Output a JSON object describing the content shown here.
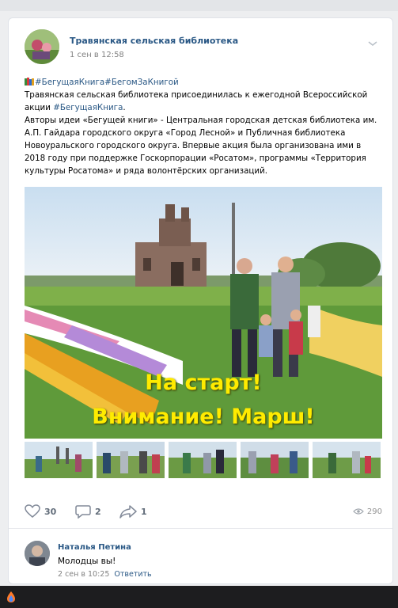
{
  "post": {
    "author": "Травянская сельская библиотека",
    "date": "1 сен в 12:58",
    "hashtags": "#БегущаяКнига#БегомЗаКнигой",
    "paragraph1_a": "Травянская сельская библиотека присоединилась к ежегодной Всероссийской акции ",
    "paragraph1_tag": "#БегущаяКнига",
    "paragraph1_b": ".",
    "paragraph2": "Авторы идеи «Бегущей книги» - Центральная городская детская библиотека им. А.П. Гайдара городского округа «Город Лесной» и Публичная библиотека Новоуральского городского округа. Впервые акция была организована ими в 2018 году при поддержке Госкорпорации «Росатом», программы «Территория культуры Росатома» и ряда волонтёрских организаций.",
    "photo_caption_line1": "На старт!",
    "photo_caption_line2": "Внимание! Марш!",
    "likes": "30",
    "comments": "2",
    "shares": "1",
    "views": "290"
  },
  "comment": {
    "author": "Наталья Петина",
    "text": "Молодцы вы!",
    "date": "2 сен в 10:25",
    "reply_label": "Ответить"
  },
  "colors": {
    "link": "#2a5885",
    "caption": "#ffeb00",
    "meta": "#828282"
  },
  "icons": [
    "chevron-down-icon",
    "books-icon",
    "heart-icon",
    "comment-icon",
    "share-icon",
    "eye-icon",
    "app-icon"
  ]
}
